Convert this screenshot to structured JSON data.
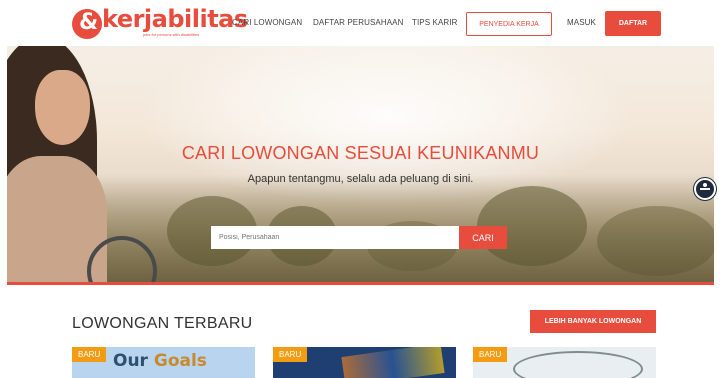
{
  "header": {
    "logo_text": "kerjabilitas",
    "logo_tagline": "jobs for persons with disabilities",
    "nav": {
      "cari_lowongan": "CARI LOWONGAN",
      "daftar_perusahaan": "DAFTAR PERUSAHAAN",
      "tips_karir": "TIPS KARIR",
      "penyedia_kerja": "PENYEDIA KERJA",
      "masuk": "MASUK",
      "daftar": "DAFTAR"
    }
  },
  "hero": {
    "title": "CARI LOWONGAN SESUAI KEUNIKANMU",
    "subtitle": "Apapun tentangmu, selalu ada peluang di sini.",
    "search_placeholder": "Posisi, Perusahaan",
    "search_button": "CARI"
  },
  "listings": {
    "title": "LOWONGAN TERBARU",
    "more_button": "LEBIH BANYAK LOWONGAN",
    "cards": [
      {
        "badge": "BARU",
        "image_text_1": "Our",
        "image_text_2": "Goals"
      },
      {
        "badge": "BARU"
      },
      {
        "badge": "BARU"
      }
    ]
  },
  "colors": {
    "brand": "#e74c3c",
    "badge": "#f39c12"
  }
}
